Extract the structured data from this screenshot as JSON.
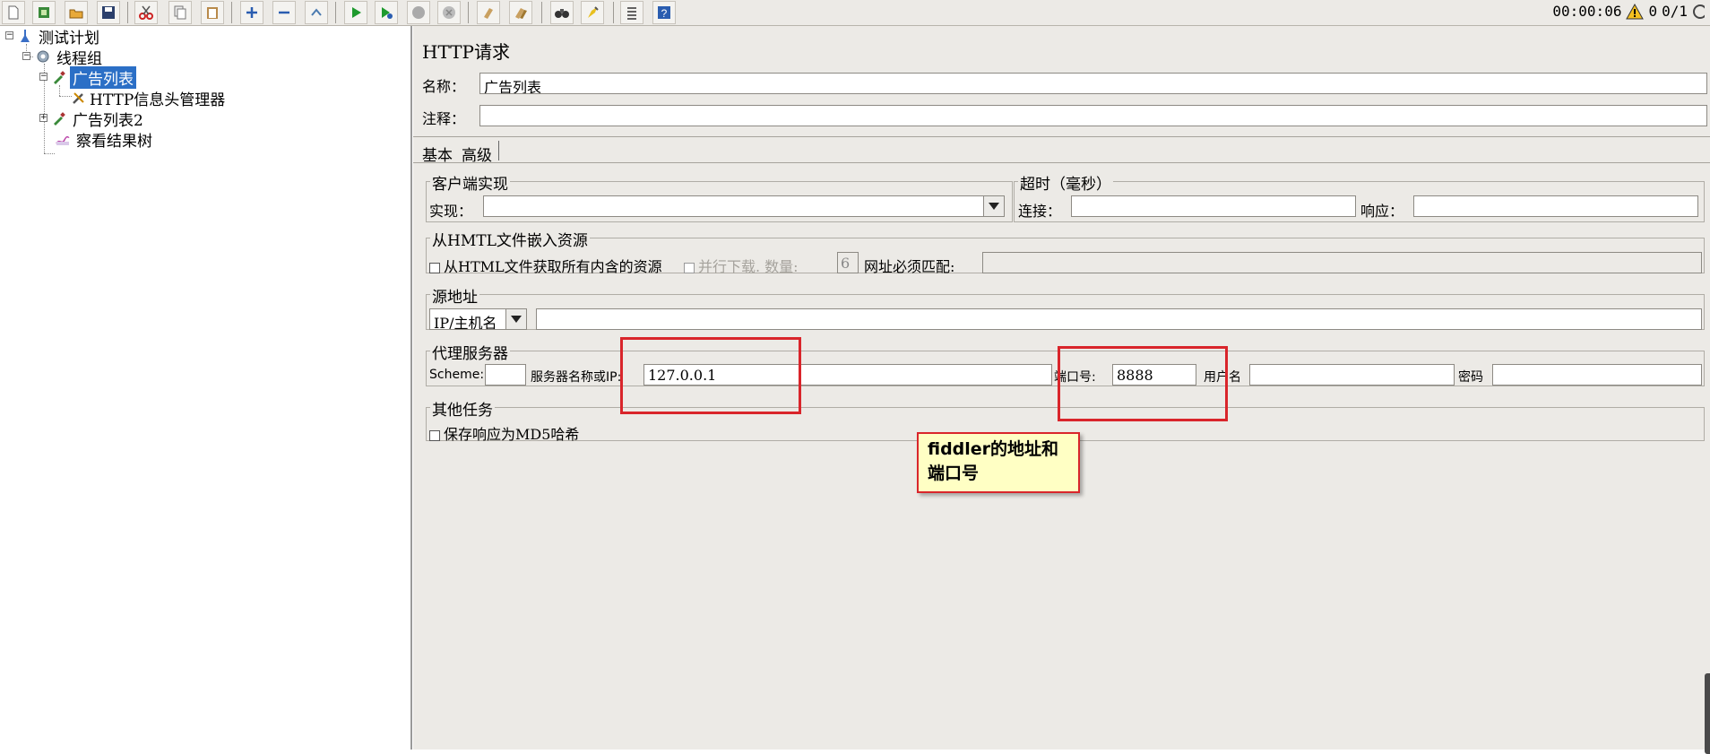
{
  "toolbar": {
    "status": {
      "elapsed": "00:00:06",
      "warnings": "0",
      "threads": "0/1"
    },
    "icons": [
      "new-icon",
      "templates-icon",
      "open-icon",
      "save-icon",
      "cut-icon",
      "copy-icon",
      "paste-icon",
      "expand-icon",
      "collapse-icon",
      "toggle-icon",
      "start-icon",
      "start-no-pause-icon",
      "stop-icon",
      "shutdown-icon",
      "clear-icon",
      "clear-all-icon",
      "search-icon",
      "reset-search-icon",
      "function-helper-icon",
      "help-icon"
    ]
  },
  "tree": {
    "items": [
      {
        "label": "测试计划"
      },
      {
        "label": "线程组"
      },
      {
        "label": "广告列表"
      },
      {
        "label": "HTTP信息头管理器"
      },
      {
        "label": "广告列表2"
      },
      {
        "label": "察看结果树"
      }
    ]
  },
  "panel": {
    "title": "HTTP请求",
    "name_label": "名称：",
    "name_value": "广告列表",
    "comment_label": "注释：",
    "comment_value": "",
    "tabs": [
      "基本",
      "高级"
    ],
    "client": {
      "title": "客户端实现",
      "impl_label": "实现：",
      "impl_value": ""
    },
    "timeout": {
      "title": "超时（毫秒）",
      "connect_label": "连接：",
      "connect_value": "",
      "response_label": "响应：",
      "response_value": ""
    },
    "embedded": {
      "title": "从HMTL文件嵌入资源",
      "retrieve_label": "从HTML文件获取所有内含的资源",
      "parallel_label": "并行下载. 数量:",
      "parallel_count": "6",
      "url_match_label": "网址必须匹配:",
      "url_match_value": ""
    },
    "source": {
      "title": "源地址",
      "type_value": "IP/主机名",
      "address_value": ""
    },
    "proxy": {
      "title": "代理服务器",
      "scheme_label": "Scheme:",
      "scheme_value": "",
      "server_label": "服务器名称或IP:",
      "server_value": "127.0.0.1",
      "port_label": "端口号:",
      "port_value": "8888",
      "user_label": "用户名",
      "user_value": "",
      "password_label": "密码",
      "password_value": ""
    },
    "other": {
      "title": "其他任务",
      "md5_label": "保存响应为MD5哈希"
    }
  },
  "annotation": {
    "line1": "fiddler的地址和",
    "line2": "端口号"
  }
}
